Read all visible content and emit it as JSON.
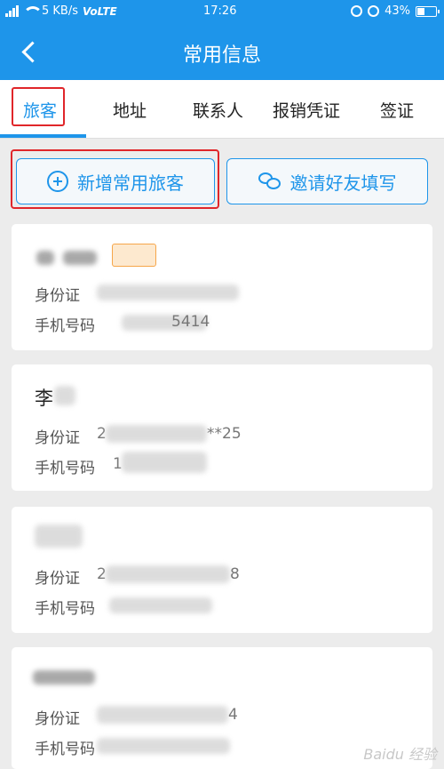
{
  "status_bar": {
    "speed": "5 KB/s",
    "network": "VoLTE",
    "time": "17:26",
    "battery": "43%",
    "battery_level": 0.43
  },
  "header": {
    "title": "常用信息"
  },
  "tabs": [
    {
      "label": "旅客",
      "active": true
    },
    {
      "label": "地址"
    },
    {
      "label": "联系人"
    },
    {
      "label": "报销凭证"
    },
    {
      "label": "签证"
    }
  ],
  "actions": {
    "add_passenger": "新增常用旅客",
    "invite_friend": "邀请好友填写"
  },
  "passengers": [
    {
      "name": "",
      "id_label": "身份证",
      "id_value": "",
      "phone_label": "手机号码",
      "phone_value": "5414"
    },
    {
      "name": "李",
      "id_label": "身份证",
      "id_value": "2",
      "id_suffix": "**25",
      "phone_label": "手机号码",
      "phone_value": "1"
    },
    {
      "name": "",
      "id_label": "身份证",
      "id_value": "2",
      "id_suffix": "8",
      "phone_label": "手机号码",
      "phone_value": ""
    },
    {
      "name": "",
      "id_label": "身份证",
      "id_value": "",
      "id_suffix": "4",
      "phone_label": "手机号码",
      "phone_value": ""
    }
  ],
  "watermark": "Baidu 经验",
  "colors": {
    "primary": "#1e95ea",
    "highlight": "#e0262a",
    "background": "#ececec"
  }
}
